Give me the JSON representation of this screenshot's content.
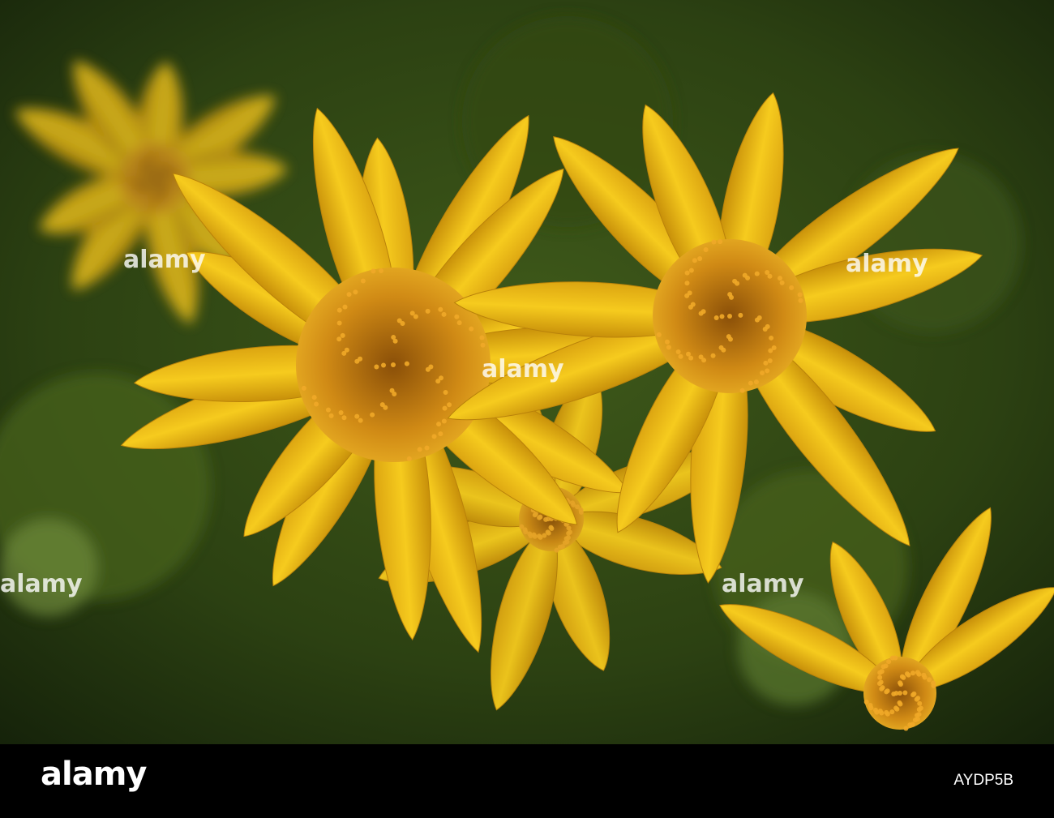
{
  "photo": {
    "subject": "yellow arnica flowers",
    "colors": {
      "background": "#2f4413",
      "petal": "#f2c318",
      "petal_shadow": "#c8900a",
      "disc": "#c27a10"
    },
    "watermark": "alamy"
  },
  "footer": {
    "logo": "alamy",
    "image_code": "AYDP5B"
  }
}
